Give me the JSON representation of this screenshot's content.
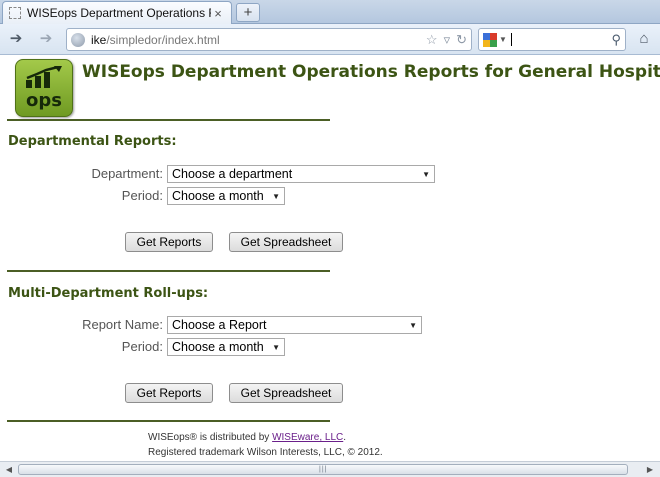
{
  "browser": {
    "tab_title": "WISEops Department Operations Reports",
    "tab_close": "×",
    "new_tab": "+",
    "url_host": "ike",
    "url_path": "/simpledor/index.html"
  },
  "header": {
    "logo_text": "ops",
    "title": "WISEops Department Operations Reports for General Hospital"
  },
  "departmental": {
    "heading": "Departmental Reports:",
    "department_label": "Department:",
    "department_value": "Choose a department",
    "period_label": "Period:",
    "period_value": "Choose a month",
    "get_reports": "Get Reports",
    "get_spreadsheet": "Get Spreadsheet"
  },
  "rollups": {
    "heading": "Multi-Department Roll-ups:",
    "report_label": "Report Name:",
    "report_value": "Choose a Report",
    "period_label": "Period:",
    "period_value": "Choose a month",
    "get_reports": "Get Reports",
    "get_spreadsheet": "Get Spreadsheet"
  },
  "footer": {
    "line1_prefix": "WISEops® is distributed by ",
    "line1_link": "WISEware, LLC",
    "line1_suffix": ".",
    "line2": "Registered trademark Wilson Interests, LLC, © 2012."
  },
  "icons": {
    "back": "back-arrow-icon",
    "forward": "forward-arrow-icon",
    "home": "home-icon",
    "search": "magnifier-icon"
  },
  "colors": {
    "title_green": "#3c5414",
    "rule": "#4b5e25",
    "logo_green": "#8ab53a",
    "link": "#6a1f8a"
  }
}
